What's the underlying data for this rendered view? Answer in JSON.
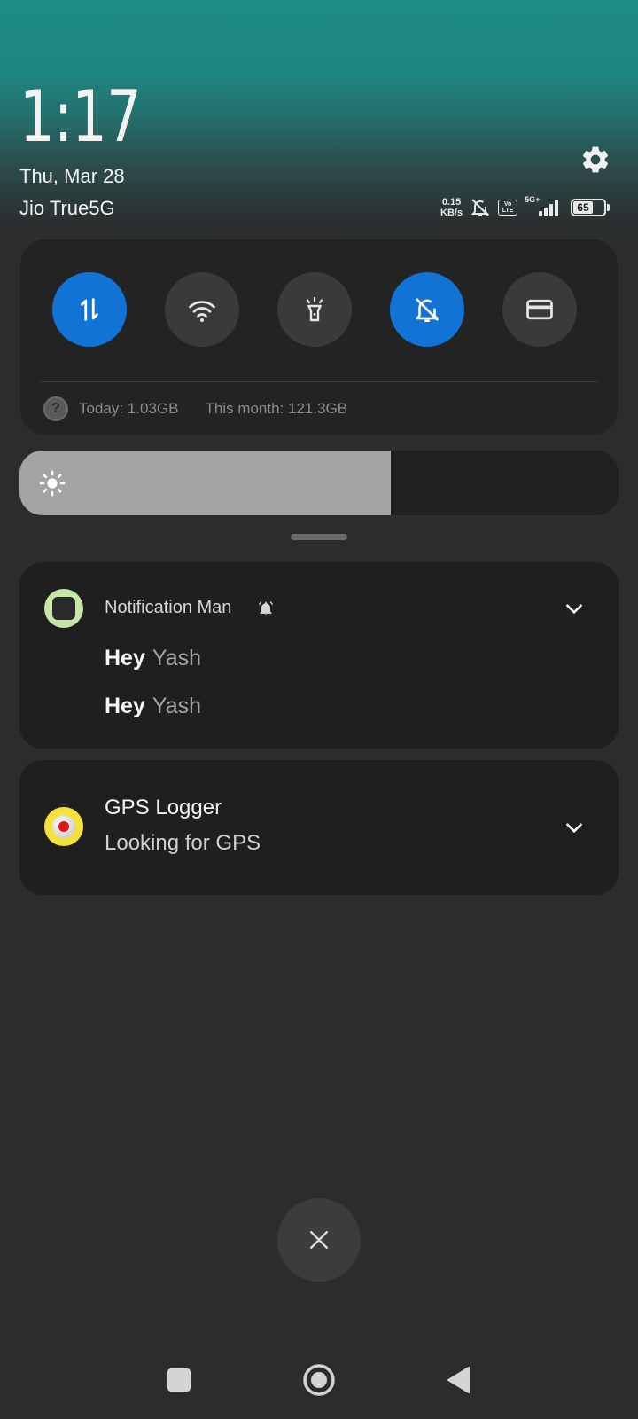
{
  "header": {
    "time": "1:17",
    "date": "Thu, Mar 28",
    "carrier": "Jio True5G",
    "settings_icon": "gear-icon"
  },
  "status": {
    "net_speed_value": "0.15",
    "net_speed_unit": "KB/s",
    "dnd_icon": "bell-off-icon",
    "volte_top": "Vo",
    "volte_bottom": "LTE",
    "network_type": "5G+",
    "battery_level": "65"
  },
  "quick_settings": {
    "toggles": [
      {
        "name": "mobile-data",
        "icon": "data-arrows-icon",
        "active": true
      },
      {
        "name": "wifi",
        "icon": "wifi-icon",
        "active": false
      },
      {
        "name": "flashlight",
        "icon": "flashlight-icon",
        "active": false
      },
      {
        "name": "silent",
        "icon": "bell-off-icon",
        "active": true
      },
      {
        "name": "card",
        "icon": "card-icon",
        "active": false
      }
    ],
    "help_glyph": "?",
    "usage_today": "Today: 1.03GB",
    "usage_month": "This month: 121.3GB",
    "accent_color": "#1273d6"
  },
  "brightness": {
    "level": 0.62,
    "icon": "sun-icon"
  },
  "notifications": [
    {
      "app": "Notification Man",
      "app_icon": "square-app-icon",
      "extra_icon": "alarm-icon",
      "messages": [
        {
          "title": "Hey",
          "text": "Yash"
        },
        {
          "title": "Hey",
          "text": "Yash"
        }
      ]
    },
    {
      "app": "GPS Logger",
      "app_icon": "record-icon",
      "text": "Looking for GPS"
    }
  ],
  "clear_all_icon": "close-icon",
  "navbar": {
    "recents_icon": "square-icon",
    "home_icon": "circle-icon",
    "back_icon": "triangle-back-icon"
  }
}
